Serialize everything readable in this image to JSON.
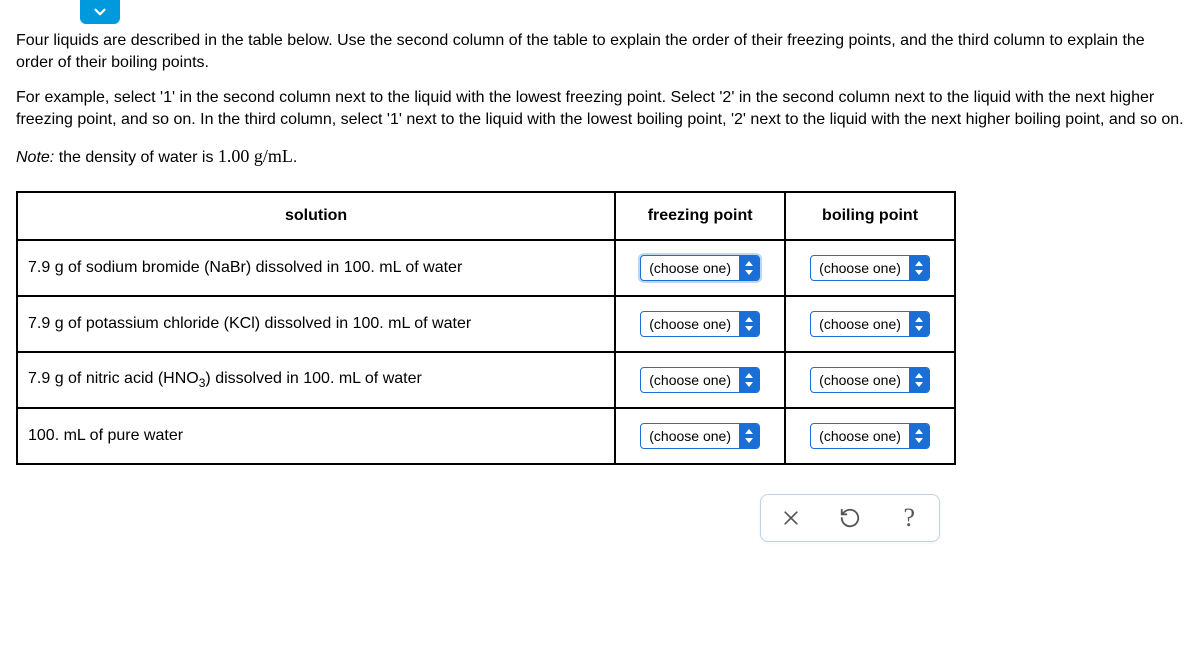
{
  "instructions": {
    "p1": "Four liquids are described in the table below. Use the second column of the table to explain the order of their freezing points, and the third column to explain the order of their boiling points.",
    "p2": "For example, select '1' in the second column next to the liquid with the lowest freezing point. Select '2' in the second column next to the liquid with the next higher freezing point, and so on. In the third column, select '1' next to the liquid with the lowest boiling point, '2' next to the liquid with the next higher boiling point, and so on.",
    "note_label": "Note:",
    "note_text": " the density of water is ",
    "density_value": "1.00 g/mL",
    "note_period": "."
  },
  "table": {
    "headers": {
      "solution": "solution",
      "freezing": "freezing point",
      "boiling": "boiling point"
    },
    "rows": [
      {
        "solution_pre": "7.9 g of sodium bromide (NaBr) dissolved in 100. mL of water",
        "has_sub": false,
        "freezing": "(choose one)",
        "boiling": "(choose one)",
        "fp_active": true
      },
      {
        "solution_pre": "7.9 g of potassium chloride (KCl) dissolved in 100. mL of water",
        "has_sub": false,
        "freezing": "(choose one)",
        "boiling": "(choose one)",
        "fp_active": false
      },
      {
        "solution_pre": "7.9 g of nitric acid (HNO",
        "solution_sub": "3",
        "solution_post": ") dissolved in 100. mL of water",
        "has_sub": true,
        "freezing": "(choose one)",
        "boiling": "(choose one)",
        "fp_active": false
      },
      {
        "solution_pre": "100. mL of pure water",
        "has_sub": false,
        "freezing": "(choose one)",
        "boiling": "(choose one)",
        "fp_active": false
      }
    ]
  }
}
